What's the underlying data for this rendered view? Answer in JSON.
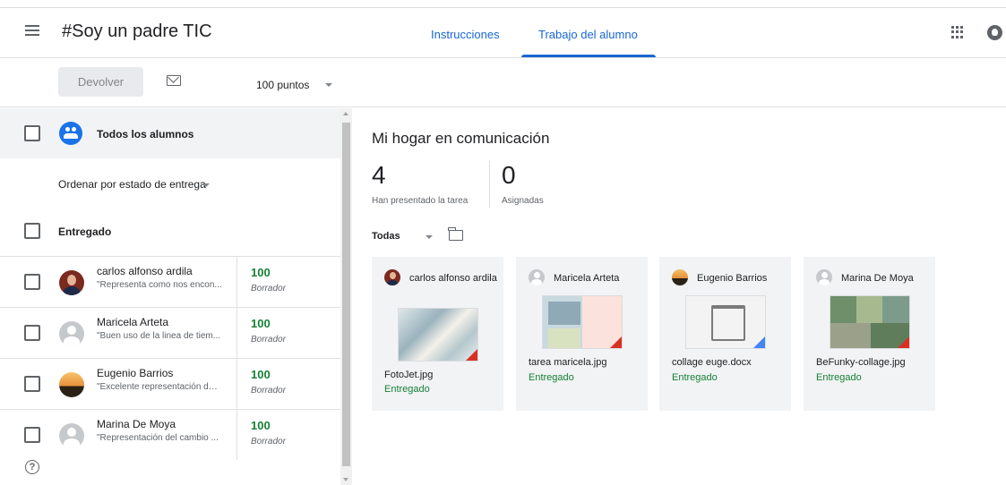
{
  "header": {
    "course_title": "#Soy un padre TIC",
    "tabs": [
      {
        "label": "Instrucciones",
        "active": false
      },
      {
        "label": "Trabajo del alumno",
        "active": true
      }
    ],
    "icons": [
      "menu-icon",
      "apps-icon",
      "account-icon"
    ]
  },
  "toolbar": {
    "return_label": "Devolver",
    "points_value": "100 puntos"
  },
  "left_panel": {
    "all_students_label": "Todos los alumnos",
    "sort_label": "Ordenar por estado de entrega",
    "section_label": "Entregado",
    "students": [
      {
        "name": "carlos alfonso ardila",
        "comment": "\"Representa como nos encon...",
        "grade": "100",
        "status": "Borrador",
        "avatar": "photo"
      },
      {
        "name": "Maricela Arteta",
        "comment": "\"Buen uso de la linea de tiem...",
        "grade": "100",
        "status": "Borrador",
        "avatar": "default"
      },
      {
        "name": "Eugenio Barrios",
        "comment": "\"Excelente representación del...",
        "grade": "100",
        "status": "Borrador",
        "avatar": "sunset"
      },
      {
        "name": "Marina De Moya",
        "comment": "\"Representación del cambio ...",
        "grade": "100",
        "status": "Borrador",
        "avatar": "default"
      }
    ]
  },
  "assignment": {
    "title": "Mi hogar en comunicación",
    "turned_in_count": "4",
    "turned_in_label": "Han presentado la tarea",
    "assigned_count": "0",
    "assigned_label": "Asignadas",
    "filter_label": "Todas",
    "cards": [
      {
        "student": "carlos alfonso ardila",
        "file": "FotoJet.jpg",
        "status": "Entregado"
      },
      {
        "student": "Maricela Arteta",
        "file": "tarea maricela.jpg",
        "status": "Entregado"
      },
      {
        "student": "Eugenio Barrios",
        "file": "collage euge.docx",
        "status": "Entregado"
      },
      {
        "student": "Marina De Moya",
        "file": "BeFunky-collage.jpg",
        "status": "Entregado"
      }
    ]
  },
  "colors": {
    "accent": "#1967d2",
    "group_icon": "#1a73e8",
    "submitted_green": "#188038",
    "card_bg": "#f1f3f4"
  }
}
